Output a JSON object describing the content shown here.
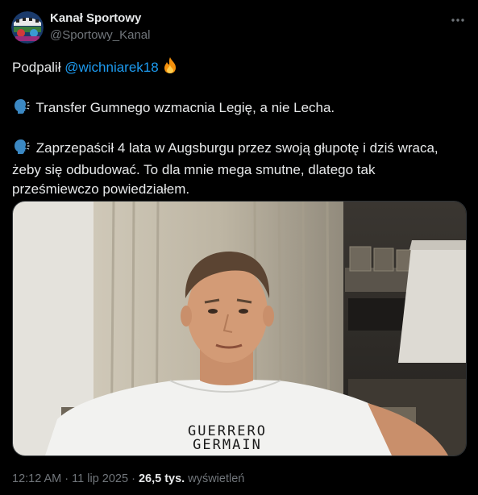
{
  "author": {
    "name": "Kanał Sportowy",
    "handle": "@Sportowy_Kanal"
  },
  "tweet": {
    "line1_prefix": "Podpalił",
    "mention": "@wichniarek18",
    "line2": "Transfer Gumnego wzmacnia Legię, a nie Lecha.",
    "line3": "Zaprzepaścił 4 lata w Augsburgu przez swoją głupotę i dziś wraca,",
    "line4": "żeby się odbudować. To dla mnie mega smutne, dlatego tak",
    "line5": "prześmiewczo powiedziałem."
  },
  "media": {
    "shirt_line1": "GUERRERO",
    "shirt_line2": "GERMAIN"
  },
  "footer": {
    "time": "12:12 AM",
    "dot1": "·",
    "date": "11 lip 2025",
    "dot2": "·",
    "views_count": "26,5 tys.",
    "views_label": "wyświetleń"
  },
  "icons": {
    "more": "more-horizontal-icon",
    "fire": "fire-emoji-icon",
    "speaking": "speaking-head-emoji-icon"
  },
  "colors": {
    "background": "#000000",
    "text": "#e7e9ea",
    "secondary": "#71767b",
    "link": "#1d9bf0"
  }
}
